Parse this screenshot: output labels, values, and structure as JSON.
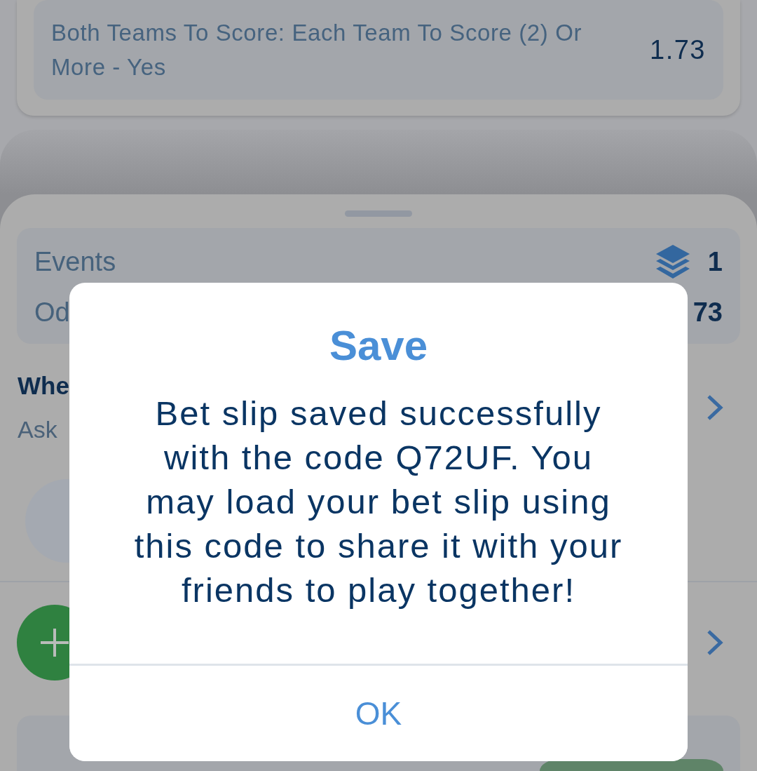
{
  "market_card": {
    "selection": "Both Teams To Score: Each Team To Score (2) Or More - Yes",
    "odds": "1.73"
  },
  "bet_slip": {
    "summary": [
      {
        "kind": "events",
        "label": "Events",
        "value": "1"
      },
      {
        "kind": "odds",
        "label": "Od",
        "value": "73"
      }
    ],
    "option": {
      "title": "Whe",
      "subtitle": "Ask"
    }
  },
  "dialog": {
    "title": "Save",
    "message_lines": [
      "Bet slip saved successfully",
      "with the code Q72UF. You",
      "may load your bet slip using",
      "this code to share it with your",
      "friends to play together!"
    ],
    "button": "OK"
  }
}
